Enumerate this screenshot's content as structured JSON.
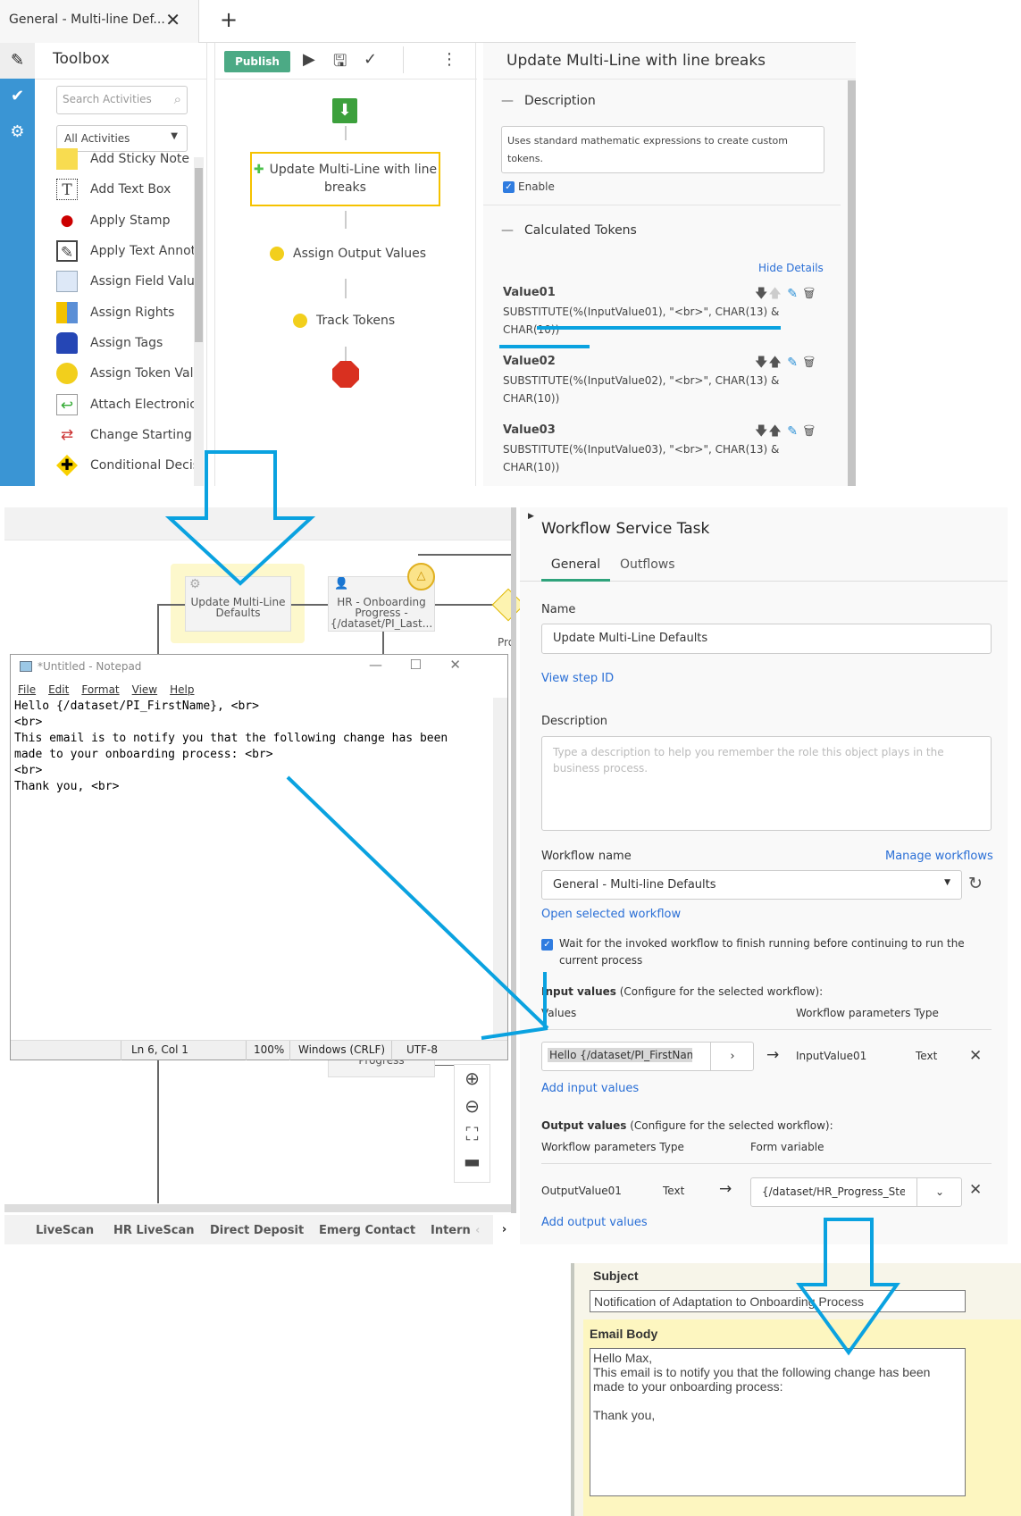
{
  "top": {
    "tab_title": "General - Multi-line Def...",
    "toolbox": {
      "title": "Toolbox",
      "search_placeholder": "Search Activities",
      "filter": "All Activities",
      "items": [
        {
          "label": "Add Sticky Note",
          "icon": "sticky-note-icon"
        },
        {
          "label": "Add Text Box",
          "icon": "text-box-icon"
        },
        {
          "label": "Apply Stamp",
          "icon": "stamp-icon"
        },
        {
          "label": "Apply Text Annotation",
          "icon": "annotation-icon"
        },
        {
          "label": "Assign Field Values",
          "icon": "field-values-icon"
        },
        {
          "label": "Assign Rights",
          "icon": "rights-icon"
        },
        {
          "label": "Assign Tags",
          "icon": "tag-icon"
        },
        {
          "label": "Assign Token Values",
          "icon": "token-icon"
        },
        {
          "label": "Attach Electronic",
          "icon": "attach-icon"
        },
        {
          "label": "Change Starting E",
          "icon": "change-icon"
        },
        {
          "label": "Conditional Decision",
          "icon": "decision-icon"
        }
      ]
    },
    "canvas": {
      "publish_label": "Publish",
      "selected_step": "Update Multi-Line with line breaks",
      "step2": "Assign Output Values",
      "step3": "Track Tokens"
    },
    "props": {
      "title": "Update Multi-Line with line breaks",
      "description_header": "Description",
      "description": "Uses standard mathematic expressions to create custom tokens.",
      "enable_label": "Enable",
      "tokens_header": "Calculated Tokens",
      "hide_details": "Hide Details",
      "tokens": [
        {
          "name": "Value01",
          "expr": "SUBSTITUTE(%(InputValue01), \"<br>\", CHAR(13) & CHAR(10))"
        },
        {
          "name": "Value02",
          "expr": "SUBSTITUTE(%(InputValue02), \"<br>\", CHAR(13) & CHAR(10))"
        },
        {
          "name": "Value03",
          "expr": "SUBSTITUTE(%(InputValue03), \"<br>\", CHAR(13) & CHAR(10))"
        }
      ]
    }
  },
  "middle": {
    "nodes": {
      "node1": "Update Multi-Line Defaults",
      "node2": "HR - Onboarding Progress - {/dataset/PI_Last...",
      "node3": "Progress",
      "partial": "Pro"
    },
    "notepad": {
      "title": "*Untitled - Notepad",
      "menu": [
        "File",
        "Edit",
        "Format",
        "View",
        "Help"
      ],
      "text": "Hello {/dataset/PI_FirstName}, <br>\n<br>\nThis email is to notify you that the following change has been\nmade to your onboarding process: <br>\n<br>\nThank you, <br>",
      "status": {
        "position": "Ln 6, Col 1",
        "zoom": "100%",
        "line_ending": "Windows (CRLF)",
        "encoding": "UTF-8"
      }
    },
    "bottom_tabs": [
      "LiveScan",
      "HR LiveScan",
      "Direct Deposit",
      "Emerg Contact",
      "Intern"
    ],
    "panel": {
      "title": "Workflow Service Task",
      "tabs": [
        "General",
        "Outflows"
      ],
      "name_label": "Name",
      "name_value": "Update Multi-Line Defaults",
      "view_step_id": "View step ID",
      "description_label": "Description",
      "description_placeholder": "Type a description to help you remember the role this object plays in the business process.",
      "workflow_name_label": "Workflow name",
      "manage_workflows": "Manage workflows",
      "workflow_name_value": "General - Multi-line Defaults",
      "open_selected": "Open selected workflow",
      "wait_label": "Wait for the invoked workflow to finish running before continuing to run the current process",
      "input_values_bold": "Input values",
      "input_values_rest": " (Configure for the selected workflow):",
      "input_col_values": "Values",
      "input_col_params": "Workflow parameters Type",
      "input_row": {
        "value": "Hello {/dataset/PI_FirstNan",
        "param": "InputValue01",
        "type": "Text"
      },
      "add_input": "Add input values",
      "output_values_bold": "Output values",
      "output_values_rest": " (Configure for the selected workflow):",
      "output_col_params": "Workflow parameters Type",
      "output_col_form": "Form variable",
      "output_row": {
        "param": "OutputValue01",
        "type": "Text",
        "variable": "{/dataset/HR_Progress_Ste"
      },
      "add_output": "Add output values"
    }
  },
  "email": {
    "subject_label": "Subject",
    "subject": "Notification of Adaptation to Onboarding Process",
    "body_label": "Email Body",
    "body_lines": [
      "Hello Max,",
      "This email is to notify you that the following change has been",
      "made to your onboarding process:",
      "",
      "Thank you,"
    ]
  },
  "colors": {
    "accent_blue": "#3a95d4",
    "publish_green": "#4caa85",
    "annotation_blue": "#0aa2e0",
    "selection_yellow": "#f5c200"
  }
}
